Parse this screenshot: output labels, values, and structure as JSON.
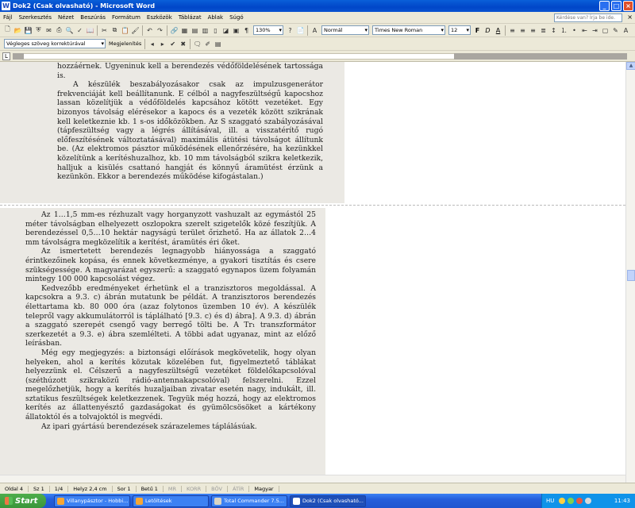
{
  "window": {
    "title": "Dok2 (Csak olvasható) - Microsoft Word",
    "app_icon": "W"
  },
  "menu": {
    "items": [
      "Fájl",
      "Szerkesztés",
      "Nézet",
      "Beszúrás",
      "Formátum",
      "Eszközök",
      "Táblázat",
      "Ablak",
      "Súgó"
    ],
    "help_placeholder": "Kérdése van? Írja be ide."
  },
  "toolbar": {
    "zoom": "130%",
    "style": "Normál",
    "font": "Times New Roman",
    "font_size": "12",
    "bold": "F",
    "italic": "D",
    "underline": "A"
  },
  "review_toolbar": {
    "display_mode": "Végleges szöveg korrektúrával",
    "show_label": "Megjelenítés"
  },
  "document": {
    "page1_paragraphs": [
      "hozzáérnek. Ugyeninuk kell a berendezés védőföldelésének tartossága is.",
      "A készülék beszabályozásakor csak az impulzusgenerátor frekvenciáját kell beállítanunk. E célból a nagyfeszültségű kapocshoz lassan közelítjük a védőföldelés kapcsához kötött vezetéket. Egy bizonyos távolság elérésekor a kapocs és a vezeték között szikrának kell keletkeznie kb. 1 s-os időközökben. Az S szaggató szabályozásával (tápfeszültség vagy a légrés állításával, ill. a visszatérítő rugó előfeszítésének változtatásával) maximális átütési távolságot állítunk be. (Az elektromos pásztor működésének ellenőrzésére, ha kezünkkel közelítünk a kerítéshuzalhoz, kb. 10 mm távolságból szikra keletkezik, halljuk a kisülés csattanó hangját és könnyű áramütést érzünk a kezünkön. Ekkor a berendezés működése kifogástalan.)"
    ],
    "page2_paragraphs": [
      "Az 1…1,5 mm-es rézhuzalt vagy horganyzott vashuzalt az egymástól 25 méter távolságban elhelyezett oszlopokra szerelt szigetelők közé feszítjük. A berendezéssel 0,5…10 hektár nagyságú terület őrizhető. Ha az állatok 2…4 mm távolságra megközelítik a kerítést, áramütés éri őket.",
      "Az ismertetett berendezés legnagyobb hiányossága a szaggató érintkezőinek kopása, és ennek következménye, a gyakori tisztítás és csere szükségessége. A magyarázat egyszerű: a szaggató egynapos üzem folyamán mintegy 100 000 kapcsolást végez.",
      "Kedvezőbb eredményeket érhetünk el a tranzisztoros megoldással. A kapcsokra a 9.3. c) ábrán mutatunk be példát. A tranzisztoros berendezés élettartama kb. 80 000 óra (azaz folytonos üzemben 10 év). A készülék telepről vagy akkumulátorról is táplálható [9.3. c) és d) ábra]. A 9.3. d) ábrán a szaggató szerepét csengő vagy berregő tölti be. A Tr₁ transzformátor szerkezetét a 9.3. e) ábra szemlélteti. A többi adat ugyanaz, mint az előző leírásban.",
      "Még egy megjegyzés: a biztonsági előírások megkövetelik, hogy olyan helyeken, ahol a kerítés közutak közelében fut, figyelmeztető táblákat helyezzünk el. Célszerű a nagyfeszültségű vezetéket földelőkapcsolóval (széthúzott szikraközű rádió-antennakapcsolóval) felszerelni. Ezzel megelőzhetjük, hogy a kerítés huzaljaiban zivatar esetén nagy, indukált, ill. sztatikus feszültségek keletkezzenek. Tegyük még hozzá, hogy az elektromos kerítés az állattenyésztő gazdaságokat és gyümölcsösöket a kártékony állatoktól és a tolvajoktól is megvédi.",
      "Az ipari gyártású berendezések szárazelemes táplálásúak."
    ]
  },
  "statusbar": {
    "page": "Oldal 4",
    "section": "Sz 1",
    "pages": "1/4",
    "position": "Helyz 2,4 cm",
    "line": "Sor 1",
    "column": "Betű 1",
    "rec": "MR",
    "trk": "KORR",
    "ext": "BŐV",
    "ovr": "ÁTÍR",
    "language": "Magyar"
  },
  "taskbar": {
    "start_label": "Start",
    "tasks": [
      "Villanypásztor - Hobbi...",
      "Letöltések",
      "Total Commander 7.5...",
      "Dok2 (Csak olvasható..."
    ],
    "lang": "HU",
    "clock": "11:43"
  }
}
